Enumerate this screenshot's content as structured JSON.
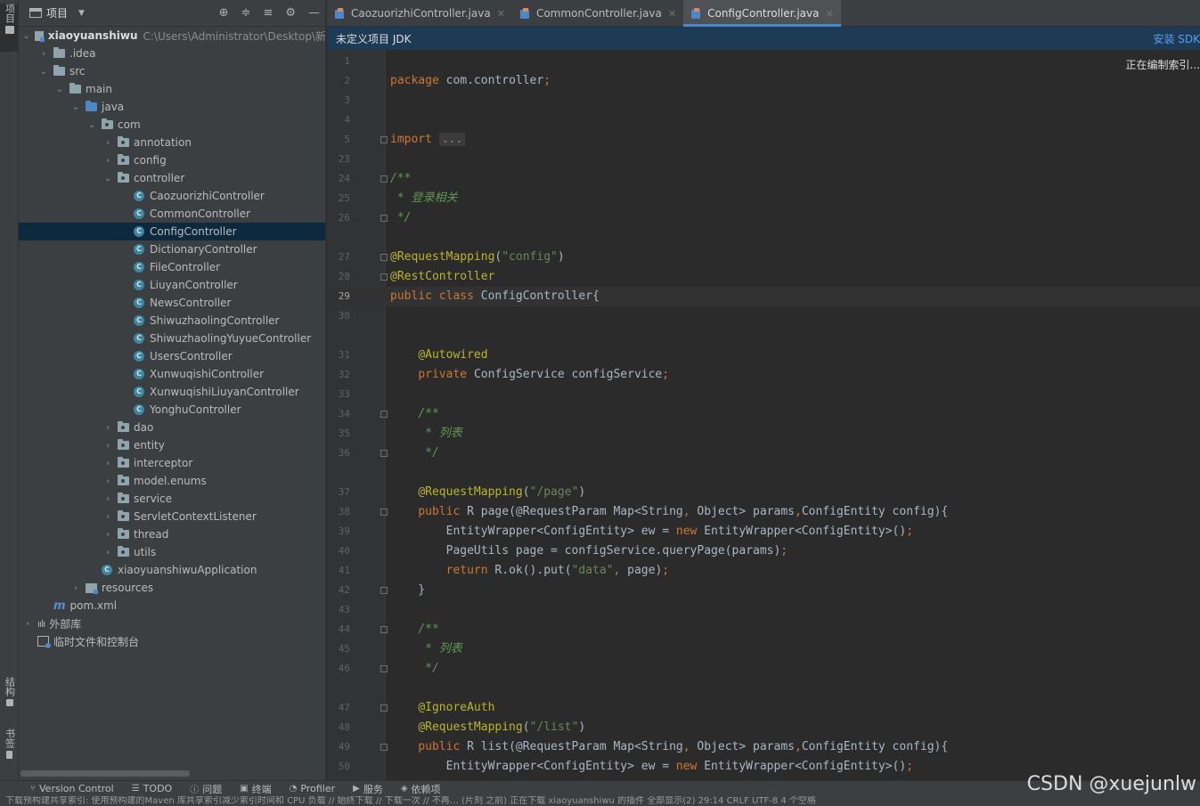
{
  "stripe": {
    "project_label": "项目",
    "structure_label": "结构",
    "bookmarks_label": "书签"
  },
  "project_panel": {
    "title": "项目",
    "tree": [
      {
        "label": "xiaoyuanshiwu",
        "path": "C:\\Users\\Administrator\\Desktop\\新",
        "icon": "module-folder",
        "expanded": true
      },
      {
        "label": ".idea",
        "icon": "folder",
        "expanded": false
      },
      {
        "label": "src",
        "icon": "folder",
        "expanded": true
      },
      {
        "label": "main",
        "icon": "folder",
        "expanded": true
      },
      {
        "label": "java",
        "icon": "source-folder",
        "expanded": true
      },
      {
        "label": "com",
        "icon": "package",
        "expanded": true
      },
      {
        "label": "annotation",
        "icon": "package",
        "expanded": false
      },
      {
        "label": "config",
        "icon": "package",
        "expanded": false
      },
      {
        "label": "controller",
        "icon": "package",
        "expanded": true
      },
      {
        "label": "CaozuorizhiController",
        "icon": "class"
      },
      {
        "label": "CommonController",
        "icon": "class"
      },
      {
        "label": "ConfigController",
        "icon": "class",
        "selected": true
      },
      {
        "label": "DictionaryController",
        "icon": "class"
      },
      {
        "label": "FileController",
        "icon": "class"
      },
      {
        "label": "LiuyanController",
        "icon": "class"
      },
      {
        "label": "NewsController",
        "icon": "class"
      },
      {
        "label": "ShiwuzhaolingController",
        "icon": "class"
      },
      {
        "label": "ShiwuzhaolingYuyueController",
        "icon": "class"
      },
      {
        "label": "UsersController",
        "icon": "class"
      },
      {
        "label": "XunwuqishiController",
        "icon": "class"
      },
      {
        "label": "XunwuqishiLiuyanController",
        "icon": "class"
      },
      {
        "label": "YonghuController",
        "icon": "class"
      },
      {
        "label": "dao",
        "icon": "package",
        "expanded": false
      },
      {
        "label": "entity",
        "icon": "package",
        "expanded": false
      },
      {
        "label": "interceptor",
        "icon": "package",
        "expanded": false
      },
      {
        "label": "model.enums",
        "icon": "package",
        "expanded": false
      },
      {
        "label": "service",
        "icon": "package",
        "expanded": false
      },
      {
        "label": "ServletContextListener",
        "icon": "package",
        "expanded": false
      },
      {
        "label": "thread",
        "icon": "package",
        "expanded": false
      },
      {
        "label": "utils",
        "icon": "package",
        "expanded": false
      },
      {
        "label": "xiaoyuanshiwuApplication",
        "icon": "class"
      },
      {
        "label": "resources",
        "icon": "resources-folder",
        "expanded": false
      },
      {
        "label": "pom.xml",
        "icon": "maven-file"
      },
      {
        "label": "外部库",
        "icon": "library",
        "expanded": false
      },
      {
        "label": "临时文件和控制台",
        "icon": "scratch"
      }
    ]
  },
  "tabs": [
    {
      "label": "CaozuorizhiController.java",
      "active": false
    },
    {
      "label": "CommonController.java",
      "active": false
    },
    {
      "label": "ConfigController.java",
      "active": true
    }
  ],
  "banner": {
    "text": "未定义项目 JDK",
    "link": "安装 SDK"
  },
  "indexing_status": "正在编制索引...",
  "code_lines": [
    {
      "n": "1",
      "tokens": []
    },
    {
      "n": "2",
      "tokens": [
        [
          "kw",
          "package"
        ],
        [
          "t",
          " com.controller"
        ],
        [
          "kw",
          ";"
        ]
      ]
    },
    {
      "n": "3",
      "tokens": []
    },
    {
      "n": "4",
      "tokens": []
    },
    {
      "n": "5",
      "tokens": [
        [
          "kw",
          "import"
        ],
        [
          "t",
          " "
        ],
        [
          "fold",
          "..."
        ]
      ],
      "fold": true
    },
    {
      "n": "23",
      "tokens": []
    },
    {
      "n": "24",
      "tokens": [
        [
          "cmt",
          "/**"
        ]
      ],
      "fold": true
    },
    {
      "n": "25",
      "tokens": [
        [
          "cmt",
          " * 登录相关"
        ]
      ]
    },
    {
      "n": "26",
      "tokens": [
        [
          "cmt",
          " */"
        ]
      ],
      "fold": true
    },
    {
      "n": "",
      "tokens": []
    },
    {
      "n": "27",
      "tokens": [
        [
          "ann",
          "@RequestMapping"
        ],
        [
          "t",
          "("
        ],
        [
          "str",
          "\"config\""
        ],
        [
          "t",
          ")"
        ]
      ],
      "fold": true
    },
    {
      "n": "28",
      "tokens": [
        [
          "ann",
          "@RestController"
        ]
      ],
      "fold": true
    },
    {
      "n": "29",
      "tokens": [
        [
          "kw",
          "public class "
        ],
        [
          "t",
          "ConfigController{"
        ]
      ],
      "current": true
    },
    {
      "n": "30",
      "tokens": []
    },
    {
      "n": "",
      "tokens": []
    },
    {
      "n": "31",
      "tokens": [
        [
          "t",
          "    "
        ],
        [
          "ann",
          "@Autowired"
        ]
      ]
    },
    {
      "n": "32",
      "tokens": [
        [
          "t",
          "    "
        ],
        [
          "kw",
          "private "
        ],
        [
          "t",
          "ConfigService configService"
        ],
        [
          "kw",
          ";"
        ]
      ]
    },
    {
      "n": "33",
      "tokens": []
    },
    {
      "n": "34",
      "tokens": [
        [
          "t",
          "    "
        ],
        [
          "cmt",
          "/**"
        ]
      ],
      "fold": true
    },
    {
      "n": "35",
      "tokens": [
        [
          "t",
          "    "
        ],
        [
          "cmt",
          " * 列表"
        ]
      ]
    },
    {
      "n": "36",
      "tokens": [
        [
          "t",
          "    "
        ],
        [
          "cmt",
          " */"
        ]
      ],
      "fold": true
    },
    {
      "n": "",
      "tokens": []
    },
    {
      "n": "37",
      "tokens": [
        [
          "t",
          "    "
        ],
        [
          "ann",
          "@RequestMapping"
        ],
        [
          "t",
          "("
        ],
        [
          "str",
          "\"/page\""
        ],
        [
          "t",
          ")"
        ]
      ]
    },
    {
      "n": "38",
      "tokens": [
        [
          "t",
          "    "
        ],
        [
          "kw",
          "public "
        ],
        [
          "t",
          "R page(@RequestParam Map<String"
        ],
        [
          "kw",
          ", "
        ],
        [
          "t",
          "Object> params"
        ],
        [
          "kw",
          ","
        ],
        [
          "t",
          "ConfigEntity config){"
        ]
      ],
      "fold": true
    },
    {
      "n": "39",
      "tokens": [
        [
          "t",
          "        EntityWrapper<ConfigEntity> ew = "
        ],
        [
          "kw",
          "new "
        ],
        [
          "t",
          "EntityWrapper<ConfigEntity>()"
        ],
        [
          "kw",
          ";"
        ]
      ]
    },
    {
      "n": "40",
      "tokens": [
        [
          "t",
          "        PageUtils page = configService.queryPage(params)"
        ],
        [
          "kw",
          ";"
        ]
      ]
    },
    {
      "n": "41",
      "tokens": [
        [
          "t",
          "        "
        ],
        [
          "kw",
          "return "
        ],
        [
          "t",
          "R.ok().put("
        ],
        [
          "str",
          "\"data\""
        ],
        [
          "kw",
          ", "
        ],
        [
          "t",
          "page)"
        ],
        [
          "kw",
          ";"
        ]
      ]
    },
    {
      "n": "42",
      "tokens": [
        [
          "t",
          "    }"
        ]
      ],
      "fold": true
    },
    {
      "n": "43",
      "tokens": []
    },
    {
      "n": "44",
      "tokens": [
        [
          "t",
          "    "
        ],
        [
          "cmt",
          "/**"
        ]
      ],
      "fold": true
    },
    {
      "n": "45",
      "tokens": [
        [
          "t",
          "    "
        ],
        [
          "cmt",
          " * 列表"
        ]
      ]
    },
    {
      "n": "46",
      "tokens": [
        [
          "t",
          "    "
        ],
        [
          "cmt",
          " */"
        ]
      ],
      "fold": true
    },
    {
      "n": "",
      "tokens": []
    },
    {
      "n": "47",
      "tokens": [
        [
          "t",
          "    "
        ],
        [
          "ann",
          "@IgnoreAuth"
        ]
      ],
      "fold": true
    },
    {
      "n": "48",
      "tokens": [
        [
          "t",
          "    "
        ],
        [
          "ann",
          "@RequestMapping"
        ],
        [
          "t",
          "("
        ],
        [
          "str",
          "\"/list\""
        ],
        [
          "t",
          ")"
        ]
      ]
    },
    {
      "n": "49",
      "tokens": [
        [
          "t",
          "    "
        ],
        [
          "kw",
          "public "
        ],
        [
          "t",
          "R list(@RequestParam Map<String"
        ],
        [
          "kw",
          ", "
        ],
        [
          "t",
          "Object> params"
        ],
        [
          "kw",
          ","
        ],
        [
          "t",
          "ConfigEntity config){"
        ]
      ],
      "fold": true
    },
    {
      "n": "50",
      "tokens": [
        [
          "t",
          "        EntityWrapper<ConfigEntity> ew = "
        ],
        [
          "kw",
          "new "
        ],
        [
          "t",
          "EntityWrapper<ConfigEntity>()"
        ],
        [
          "kw",
          ";"
        ]
      ]
    }
  ],
  "bottom_tools": [
    {
      "label": "Version Control",
      "icon": "branch-icon"
    },
    {
      "label": "TODO",
      "icon": "list-icon"
    },
    {
      "label": "问题",
      "icon": "info-icon"
    },
    {
      "label": "终端",
      "icon": "terminal-icon"
    },
    {
      "label": "Profiler",
      "icon": "profiler-icon"
    },
    {
      "label": "服务",
      "icon": "play-icon"
    },
    {
      "label": "依赖项",
      "icon": "layers-icon"
    }
  ],
  "status_bar": "下载预构建共享索引: 使用预构建的Maven 库共享索引减少索引时间和 CPU 负载 // 始终下载 // 下载一次 // 不再… (片刻 之前)      正在下载 xiaoyuanshiwu 的插件          全部显示(2)    29:14   CRLF   UTF-8   4 个空格",
  "watermark": "CSDN @xuejunlw"
}
